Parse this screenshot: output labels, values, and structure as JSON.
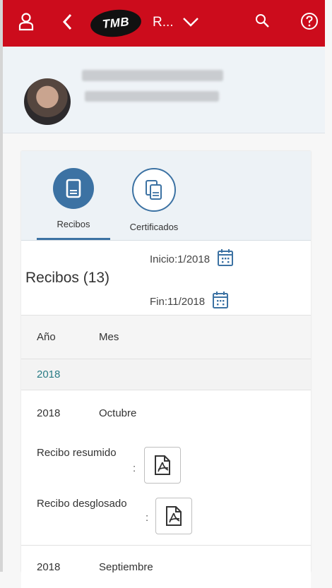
{
  "topbar": {
    "logo_text": "TMB",
    "app_title": "R...",
    "bg_color": "#cc0c1c"
  },
  "tabs": [
    {
      "label": "Recibos",
      "selected": true
    },
    {
      "label": "Certificados",
      "selected": false
    }
  ],
  "section": {
    "title": "Recibos (13)",
    "start_label": "Inicio:1/2018",
    "end_label": "Fin:11/2018"
  },
  "table": {
    "columns": [
      "Año",
      "Mes"
    ],
    "group": "2018",
    "rows": [
      {
        "year": "2018",
        "month": "Octubre",
        "doc1_label": "Recibo resumido",
        "doc2_label": "Recibo desglosado",
        "colon": ":"
      },
      {
        "year": "2018",
        "month": "Septiembre"
      }
    ]
  },
  "colors": {
    "accent": "#3c72a3",
    "group_text": "#2a7c85"
  }
}
